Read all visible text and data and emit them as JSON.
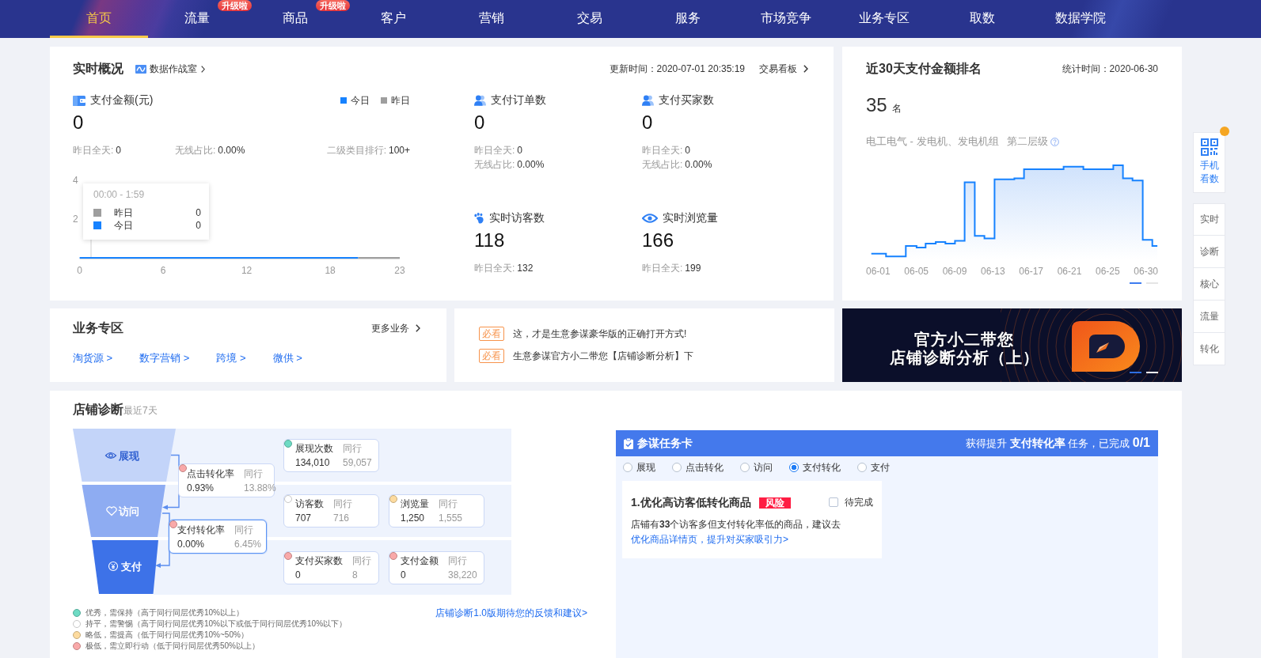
{
  "top_nav": {
    "tabs": [
      {
        "label": "首页",
        "selected": true
      },
      {
        "label": "流量",
        "selected": false,
        "badge": "升级啦"
      },
      {
        "label": "商品",
        "selected": false,
        "badge": "升级啦"
      },
      {
        "label": "客户",
        "selected": false
      },
      {
        "label": "营销",
        "selected": false
      },
      {
        "label": "交易",
        "selected": false
      },
      {
        "label": "服务",
        "selected": false
      },
      {
        "label": "市场竞争",
        "selected": false
      },
      {
        "label": "业务专区",
        "selected": false
      },
      {
        "label": "取数",
        "selected": false
      },
      {
        "label": "数据学院",
        "selected": false
      }
    ]
  },
  "realtime": {
    "title": "实时概况",
    "war_room_link": "数据作战室",
    "update_time": "更新时间：2020-07-01 20:35:19",
    "board_link": "交易看板",
    "payment": {
      "label": "支付金额(元)",
      "value": "0",
      "stats": [
        {
          "label": "昨日全天:",
          "value": "0"
        },
        {
          "label": "无线占比:",
          "value": "0.00%"
        },
        {
          "label": "二级类目排行:",
          "value": "100+"
        }
      ],
      "chart_data": {
        "type": "line",
        "x": [
          0,
          1,
          2,
          3,
          4,
          5,
          6,
          7,
          8,
          9,
          10,
          11,
          12,
          13,
          14,
          15,
          16,
          17,
          18,
          19,
          20,
          21,
          22,
          23
        ],
        "xlim": [
          0,
          23
        ],
        "ylim": [
          0,
          4
        ],
        "xticks": [
          0,
          6,
          12,
          18,
          23
        ],
        "yticks": [
          2,
          4
        ],
        "series": [
          {
            "name": "今日",
            "color": "#1682ff",
            "values": [
              0,
              0,
              0,
              0,
              0,
              0,
              0,
              0,
              0,
              0,
              0,
              0,
              0,
              0,
              0,
              0,
              0,
              0,
              0,
              0,
              0,
              null,
              null,
              null
            ]
          },
          {
            "name": "昨日",
            "color": "#9e9e9e",
            "values": [
              null,
              null,
              null,
              null,
              null,
              null,
              null,
              null,
              null,
              null,
              null,
              null,
              null,
              null,
              null,
              null,
              null,
              null,
              null,
              null,
              0,
              0,
              0,
              0
            ]
          }
        ]
      },
      "tooltip": {
        "time": "00:00 - 1:59",
        "rows": [
          {
            "label": "昨日",
            "value": "0",
            "color": "#9e9e9e"
          },
          {
            "label": "今日",
            "value": "0",
            "color": "#1682ff"
          }
        ]
      }
    },
    "metrics": [
      {
        "kind": "people",
        "label": "支付订单数",
        "value": "0",
        "stats": [
          {
            "label": "昨日全天:",
            "value": "0"
          },
          {
            "label": "无线占比:",
            "value": "0.00%"
          }
        ]
      },
      {
        "kind": "people",
        "label": "支付买家数",
        "value": "0",
        "stats": [
          {
            "label": "昨日全天:",
            "value": "0"
          },
          {
            "label": "无线占比:",
            "value": "0.00%"
          }
        ]
      },
      {
        "kind": "footprint",
        "label": "实时访客数",
        "value": "118",
        "stats": [
          {
            "label": "昨日全天:",
            "value": "132"
          }
        ]
      },
      {
        "kind": "eye",
        "label": "实时浏览量",
        "value": "166",
        "stats": [
          {
            "label": "昨日全天:",
            "value": "199"
          }
        ]
      }
    ]
  },
  "ranking": {
    "title": "近30天支付金额排名",
    "stat_time": "统计时间：2020-06-30",
    "rank": "35",
    "rank_unit": "名",
    "category": "电工电气 - 发电机、发电机组",
    "tier": "第二层级",
    "x_labels": [
      "06-01",
      "06-05",
      "06-09",
      "06-13",
      "06-17",
      "06-21",
      "06-25",
      "06-30"
    ],
    "pages": [
      {
        "selected": true
      },
      {
        "selected": false
      }
    ]
  },
  "side_panel": {
    "mobile_label": "手机看数",
    "unread": true,
    "items": [
      "实时",
      "诊断",
      "核心",
      "流量",
      "转化"
    ]
  },
  "business": {
    "title": "业务专区",
    "more": "更多业务",
    "links": [
      "淘货源 >",
      "数字营销 >",
      "跨境 >",
      "微供 >"
    ]
  },
  "notices": [
    {
      "tag": "必看",
      "text": "这，才是生意参谋豪华版的正确打开方式!"
    },
    {
      "tag": "必看",
      "text": "生意参谋官方小二带您【店铺诊断分析】下"
    }
  ],
  "banner": {
    "lines": [
      "官方小二带您",
      "店铺诊断分析（上）"
    ],
    "pages": [
      {
        "selected": true
      },
      {
        "selected": false
      }
    ]
  },
  "diagnosis": {
    "title": "店铺诊断",
    "period": "最近7天",
    "stages": [
      {
        "kind": "eye",
        "label": "展现",
        "color": "#c3d4f9",
        "metrics": [
          {
            "name": "展现次数",
            "peer_label": "同行",
            "value": "134,010",
            "peer": "59,057",
            "color": "#6edbc4"
          }
        ]
      },
      {
        "kind": "heart",
        "label": "访问",
        "color": "#8eacf2",
        "metrics": [
          {
            "name": "访客数",
            "peer_label": "同行",
            "value": "707",
            "peer": "716",
            "color": "#ffffff"
          },
          {
            "name": "浏览量",
            "peer_label": "同行",
            "value": "1,250",
            "peer": "1,555",
            "color": "#fddb9f"
          }
        ]
      },
      {
        "kind": "yen",
        "label": "支付",
        "color": "#3d72e8",
        "metrics": [
          {
            "name": "支付买家数",
            "peer_label": "同行",
            "value": "0",
            "peer": "8",
            "color": "#f9a9a9"
          },
          {
            "name": "支付金额",
            "peer_label": "同行",
            "value": "0",
            "peer": "38,220",
            "color": "#f9a9a9"
          }
        ]
      }
    ],
    "conversions": [
      {
        "name": "点击转化率",
        "peer_label": "同行",
        "value": "0.93%",
        "peer": "13.88%",
        "color": "#f9a9a9",
        "selected": false
      },
      {
        "name": "支付转化率",
        "peer_label": "同行",
        "value": "0.00%",
        "peer": "6.45%",
        "color": "#f9a9a9",
        "selected": true
      }
    ],
    "legend": [
      {
        "text": "优秀，需保持（高于同行同层优秀10%以上）",
        "color": "#6edbc4"
      },
      {
        "text": "持平，需警惕（高于同行同层优秀10%以下或低于同行同层优秀10%以下）",
        "color": "#ffffff"
      },
      {
        "text": "略低，需提高（低于同行同层优秀10%~50%）",
        "color": "#fddb9f"
      },
      {
        "text": "极低，需立即行动（低于同行同层优秀50%以上）",
        "color": "#f9a9a9"
      }
    ],
    "feedback_link": "店铺诊断1.0版期待您的反馈和建议>"
  },
  "task_card": {
    "title": "参谋任务卡",
    "summary": "获得提升 **支付转化率** 任务，已完成 **0/1**",
    "options": [
      {
        "label": "展现",
        "selected": false
      },
      {
        "label": "点击转化",
        "selected": false
      },
      {
        "label": "访问",
        "selected": false
      },
      {
        "label": "支付转化",
        "selected": true
      },
      {
        "label": "支付",
        "selected": false
      }
    ],
    "tasks": [
      {
        "title": "1.优化高访客低转化商品",
        "tag": "风险",
        "status_label": "待完成",
        "checked": false,
        "description": "店铺有**33**个访客多但支付转化率低的商品，建议去",
        "link": "优化商品详情页，提升对买家吸引力>"
      }
    ]
  }
}
